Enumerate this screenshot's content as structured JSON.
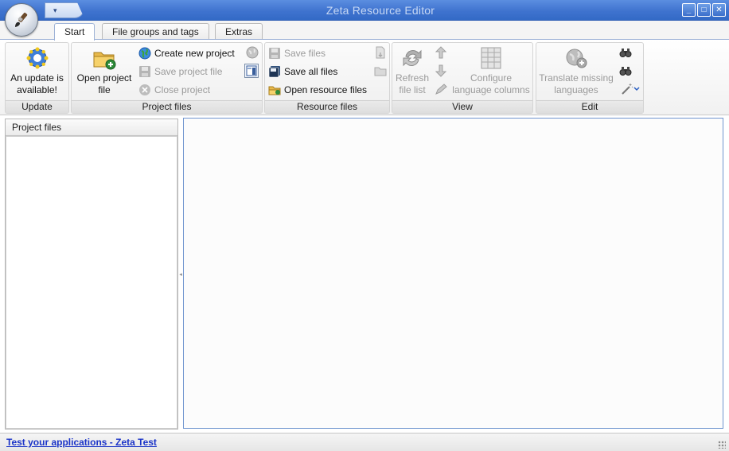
{
  "window": {
    "title": "Zeta Resource Editor",
    "quick_access_label": "▾",
    "buttons": {
      "minimize": "_",
      "maximize": "□",
      "close": "✕"
    }
  },
  "tabs": [
    {
      "label": "Start",
      "active": true
    },
    {
      "label": "File groups and tags",
      "active": false
    },
    {
      "label": "Extras",
      "active": false
    }
  ],
  "ribbon": {
    "update": {
      "label": "Update",
      "button_line1": "An update is",
      "button_line2": "available!"
    },
    "project_files": {
      "label": "Project files",
      "open_line1": "Open project",
      "open_line2": "file",
      "create": "Create new project",
      "save": "Save project file",
      "close": "Close project"
    },
    "resource_files": {
      "label": "Resource files",
      "save": "Save files",
      "save_all": "Save all files",
      "open": "Open resource files"
    },
    "view": {
      "label": "View",
      "refresh_line1": "Refresh",
      "refresh_line2": "file list",
      "configure_line1": "Configure",
      "configure_line2": "language columns"
    },
    "edit": {
      "label": "Edit",
      "translate_line1": "Translate missing",
      "translate_line2": "languages"
    }
  },
  "left_panel": {
    "title": "Project files"
  },
  "status_bar": {
    "link": "Test your applications - Zeta Test"
  }
}
